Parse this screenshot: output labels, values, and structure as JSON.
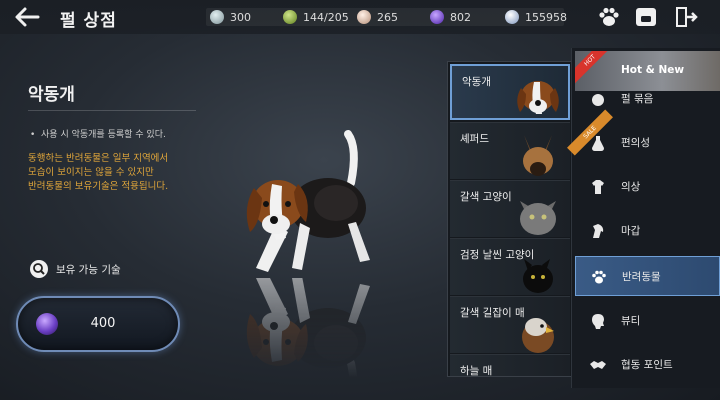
{
  "header": {
    "title": "펄 상점",
    "currencies": [
      {
        "name": "silver",
        "value": "300",
        "color": "#9fb3b8"
      },
      {
        "name": "energy",
        "value": "144/205",
        "color": "#8fb33c"
      },
      {
        "name": "pearl-shard",
        "value": "265",
        "color": "#d9b9a5"
      },
      {
        "name": "purple-gem",
        "value": "802",
        "color": "#7a4de0"
      },
      {
        "name": "crystal",
        "value": "155958",
        "color": "#b6c8e8"
      }
    ]
  },
  "pet": {
    "name": "악동개",
    "bullet": "사용 시 악동개를 등록할 수 있다.",
    "note_lines": [
      "동행하는 반려동물은 일부 지역에서",
      "모습이 보이지는 않을 수 있지만",
      "반려동물의 보유기술은 적용됩니다."
    ],
    "skill_label": "보유 가능 기술",
    "price": "400"
  },
  "pet_list": [
    {
      "label": "악동개",
      "selected": true
    },
    {
      "label": "셰퍼드",
      "selected": false
    },
    {
      "label": "갈색 고양이",
      "selected": false
    },
    {
      "label": "검정 날씬 고양이",
      "selected": false
    },
    {
      "label": "갈색 길잡이 매",
      "selected": false
    },
    {
      "label": "하늘 매",
      "selected": false
    }
  ],
  "menu": {
    "hot": {
      "label": "Hot & New",
      "badge": "HOT"
    },
    "items": [
      {
        "label": "펄 묶음",
        "icon": "bundle-icon"
      },
      {
        "label": "편의성",
        "icon": "potion-icon",
        "badge": "SALE"
      },
      {
        "label": "의상",
        "icon": "costume-icon"
      },
      {
        "label": "마갑",
        "icon": "horse-armor-icon"
      },
      {
        "label": "반려동물",
        "icon": "paw-icon",
        "selected": true
      },
      {
        "label": "뷰티",
        "icon": "beauty-icon"
      },
      {
        "label": "협동 포인트",
        "icon": "handshake-icon"
      }
    ]
  }
}
